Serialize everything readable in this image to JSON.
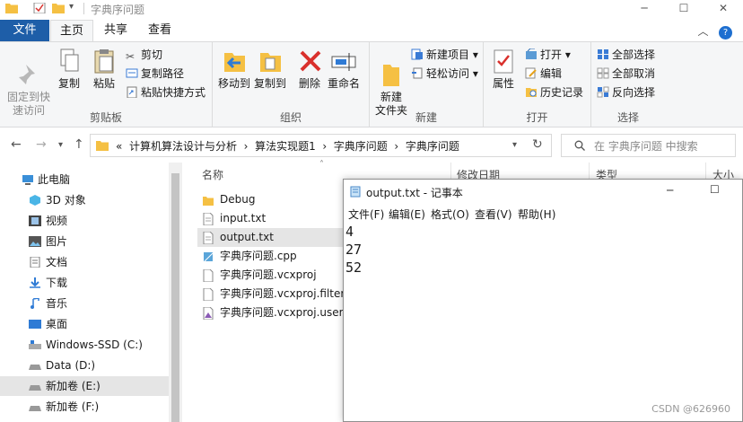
{
  "window": {
    "title": "字典序问题"
  },
  "ribbon_tabs": [
    "文件",
    "主页",
    "共享",
    "查看"
  ],
  "ribbon": {
    "clipboard": {
      "label": "剪贴板",
      "pin": "固定到快\n速访问",
      "copy": "复制",
      "paste": "粘贴",
      "cut": "剪切",
      "copy_path": "复制路径",
      "paste_shortcut": "粘贴快捷方式"
    },
    "organize": {
      "label": "组织",
      "move_to": "移动到",
      "copy_to": "复制到",
      "delete": "删除",
      "rename": "重命名"
    },
    "new": {
      "label": "新建",
      "new_folder": "新建\n文件夹",
      "new_item": "新建项目",
      "easy_access": "轻松访问"
    },
    "open": {
      "label": "打开",
      "properties": "属性",
      "open": "打开",
      "edit": "编辑",
      "history": "历史记录"
    },
    "select": {
      "label": "选择",
      "select_all": "全部选择",
      "select_none": "全部取消",
      "invert": "反向选择"
    }
  },
  "address": {
    "prefix": "«",
    "crumbs": [
      "计算机算法设计与分析",
      "算法实现题1",
      "字典序问题",
      "字典序问题"
    ],
    "search_placeholder": "在 字典序问题 中搜索"
  },
  "nav_items": [
    "此电脑",
    "3D 对象",
    "视频",
    "图片",
    "文档",
    "下载",
    "音乐",
    "桌面",
    "Windows-SSD (C:)",
    "Data (D:)",
    "新加卷 (E:)",
    "新加卷 (F:)"
  ],
  "columns": {
    "name": "名称",
    "modified": "修改日期",
    "type": "类型",
    "size": "大小"
  },
  "files": [
    "Debug",
    "input.txt",
    "output.txt",
    "字典序问题.cpp",
    "字典序问题.vcxproj",
    "字典序问题.vcxproj.filters",
    "字典序问题.vcxproj.user"
  ],
  "notepad": {
    "title": "output.txt - 记事本",
    "menus": [
      "文件(F)",
      "编辑(E)",
      "格式(O)",
      "查看(V)",
      "帮助(H)"
    ],
    "lines": [
      "4",
      "27",
      "52"
    ]
  },
  "watermark": "CSDN @626960",
  "colors": {
    "file_tab": "#1e5ea8",
    "selected": "#e5e5e5",
    "folder": "#f5c043"
  }
}
